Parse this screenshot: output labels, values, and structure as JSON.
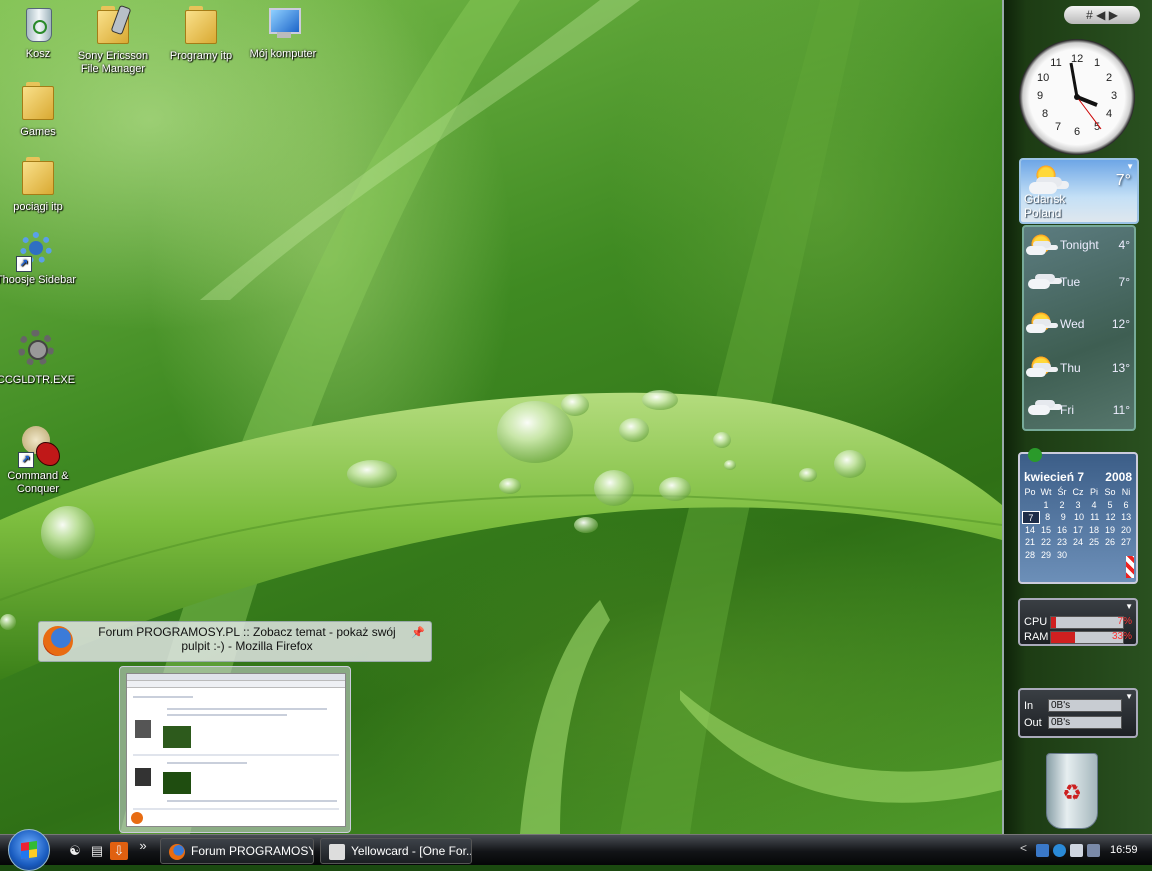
{
  "desktop": {
    "icons": [
      {
        "label": "Kosz"
      },
      {
        "label": "Sony Ericsson File Manager"
      },
      {
        "label": "Programy itp"
      },
      {
        "label": "Mój komputer"
      },
      {
        "label": "Games"
      },
      {
        "label": "pociągi itp"
      },
      {
        "label": "Thoosje Sidebar"
      },
      {
        "label": "CCGLDTR.EXE"
      },
      {
        "label": "Command & Conquer"
      }
    ]
  },
  "tooltip": {
    "title": "Forum PROGRAMOSY.PL :: Zobacz temat - pokaż swój pulpit :-) - Mozilla Firefox",
    "pin_icon": "pin-icon"
  },
  "sidebar": {
    "top_icon": "#",
    "weather": {
      "city": "Gdansk",
      "country": "Poland",
      "temp": "7°",
      "forecast": [
        {
          "day": "Tonight",
          "temp": "4°"
        },
        {
          "day": "Tue",
          "temp": "7°"
        },
        {
          "day": "Wed",
          "temp": "12°"
        },
        {
          "day": "Thu",
          "temp": "13°"
        },
        {
          "day": "Fri",
          "temp": "11°"
        }
      ]
    },
    "calendar": {
      "month_label": "kwiecień 7",
      "year": "2008",
      "weekdays": [
        "Po",
        "Wt",
        "Śr",
        "Cz",
        "Pi",
        "So",
        "Ni"
      ],
      "weeks": [
        [
          "",
          "1",
          "2",
          "3",
          "4",
          "5",
          "6"
        ],
        [
          "7",
          "8",
          "9",
          "10",
          "11",
          "12",
          "13"
        ],
        [
          "14",
          "15",
          "16",
          "17",
          "18",
          "19",
          "20"
        ],
        [
          "21",
          "22",
          "23",
          "24",
          "25",
          "26",
          "27"
        ],
        [
          "28",
          "29",
          "30",
          "",
          "",
          "",
          ""
        ]
      ],
      "today": "7"
    },
    "system_meter": {
      "cpu_label": "CPU",
      "ram_label": "RAM",
      "cpu_value": "7%",
      "ram_value": "33%"
    },
    "network_meter": {
      "in_label": "In",
      "out_label": "Out",
      "in_value": "0B's",
      "out_value": "0B's"
    }
  },
  "taskbar": {
    "windows": [
      {
        "label": "Forum PROGRAMOSY..."
      },
      {
        "label": "Yellowcard - [One For..."
      }
    ],
    "overflow": "»",
    "tray_chevron": "<",
    "clock": "16:59"
  },
  "colors": {
    "taskbar": "#121417",
    "sidebar": "#1d3c14",
    "meter_red": "#d02020"
  }
}
